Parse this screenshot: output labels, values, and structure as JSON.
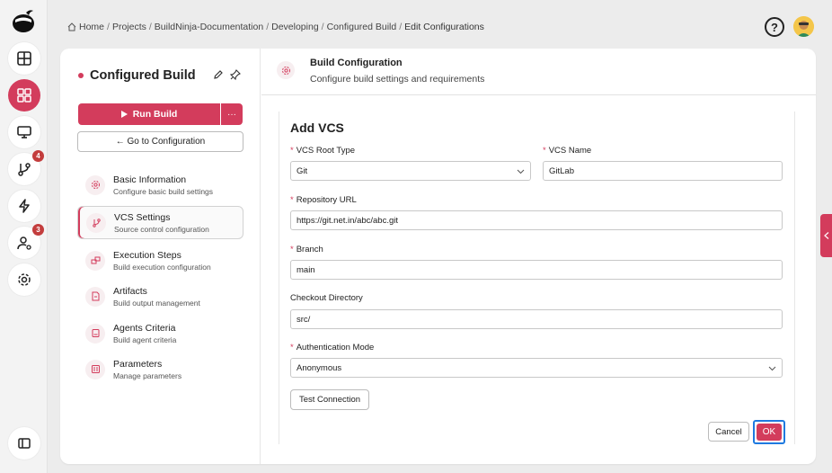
{
  "breadcrumb": [
    "Home",
    "Projects",
    "BuildNinja-Documentation",
    "Developing",
    "Configured Build",
    "Edit Configurations"
  ],
  "header": {
    "help_label": "?"
  },
  "rail": {
    "badges": {
      "merge": "4",
      "agents": "3"
    }
  },
  "build": {
    "title": "Configured Build",
    "run_label": "Run Build",
    "more_label": "···",
    "goto_label": "← Go to Configuration"
  },
  "nav": [
    {
      "title": "Basic Information",
      "sub": "Configure basic build settings"
    },
    {
      "title": "VCS Settings",
      "sub": "Source control configuration"
    },
    {
      "title": "Execution Steps",
      "sub": "Build execution configuration"
    },
    {
      "title": "Artifacts",
      "sub": "Build output management"
    },
    {
      "title": "Agents Criteria",
      "sub": "Build agent criteria"
    },
    {
      "title": "Parameters",
      "sub": "Manage parameters"
    }
  ],
  "panel": {
    "title": "Build Configuration",
    "subtitle": "Configure build settings and requirements"
  },
  "form": {
    "title": "Add VCS",
    "required_mark": "*",
    "vcs_root_type": {
      "label": "VCS Root Type",
      "value": "Git"
    },
    "vcs_name": {
      "label": "VCS Name",
      "value": "GitLab"
    },
    "repository_url": {
      "label": "Repository URL",
      "value": "https://git.net.in/abc/abc.git"
    },
    "branch": {
      "label": "Branch",
      "value": "main"
    },
    "checkout_directory": {
      "label": "Checkout Directory",
      "value": "src/"
    },
    "auth_mode": {
      "label": "Authentication Mode",
      "value": "Anonymous"
    },
    "test_connection_label": "Test Connection",
    "cancel_label": "Cancel",
    "ok_label": "OK"
  },
  "colors": {
    "accent": "#d33c5c",
    "focus": "#1f7ae0"
  }
}
